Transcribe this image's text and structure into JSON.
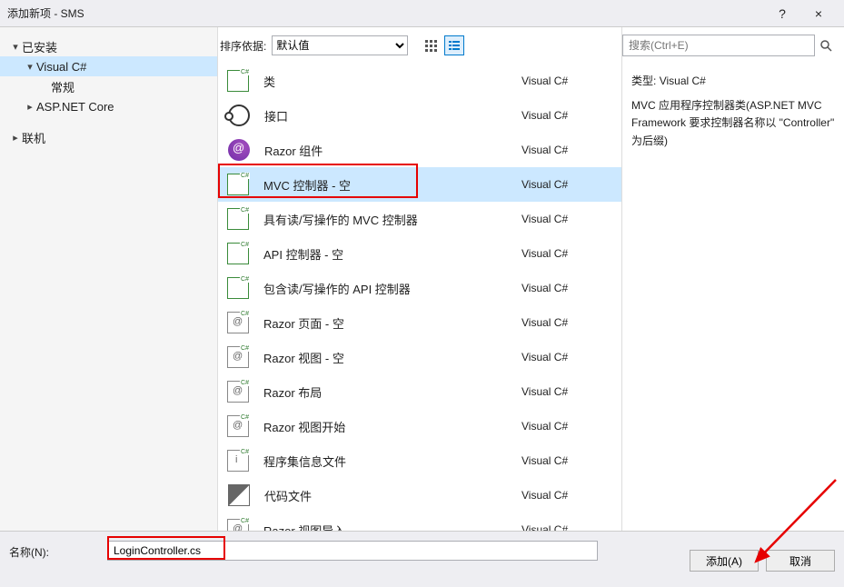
{
  "window": {
    "title": "添加新项 - SMS",
    "help": "?",
    "close": "×"
  },
  "sidebar": {
    "installed": "已安装",
    "visualcs": "Visual C#",
    "general": "常规",
    "aspnetcore": "ASP.NET Core",
    "online": "联机"
  },
  "toolbar": {
    "sortby": "排序依据:",
    "sortvalue": "默认值"
  },
  "items": [
    {
      "label": "类",
      "lang": "Visual C#",
      "ico": "ico-cs"
    },
    {
      "label": "接口",
      "lang": "Visual C#",
      "ico": "ico-interface"
    },
    {
      "label": "Razor 组件",
      "lang": "Visual C#",
      "ico": "ico-razor"
    },
    {
      "label": "MVC 控制器 - 空",
      "lang": "Visual C#",
      "ico": "ico-cs",
      "selected": true
    },
    {
      "label": "具有读/写操作的 MVC 控制器",
      "lang": "Visual C#",
      "ico": "ico-cs"
    },
    {
      "label": "API 控制器 - 空",
      "lang": "Visual C#",
      "ico": "ico-cs"
    },
    {
      "label": "包含读/写操作的 API 控制器",
      "lang": "Visual C#",
      "ico": "ico-cs"
    },
    {
      "label": "Razor 页面 - 空",
      "lang": "Visual C#",
      "ico": "ico-rzfile"
    },
    {
      "label": "Razor 视图 - 空",
      "lang": "Visual C#",
      "ico": "ico-rzfile"
    },
    {
      "label": "Razor 布局",
      "lang": "Visual C#",
      "ico": "ico-rzfile"
    },
    {
      "label": "Razor 视图开始",
      "lang": "Visual C#",
      "ico": "ico-rzfile"
    },
    {
      "label": "程序集信息文件",
      "lang": "Visual C#",
      "ico": "ico-info"
    },
    {
      "label": "代码文件",
      "lang": "Visual C#",
      "ico": "ico-code"
    },
    {
      "label": "Razor 视图导入",
      "lang": "Visual C#",
      "ico": "ico-rzfile"
    }
  ],
  "search": {
    "placeholder": "搜索(Ctrl+E)"
  },
  "detail": {
    "type_label": "类型:",
    "type_value": "Visual C#",
    "desc": "MVC 应用程序控制器类(ASP.NET MVC Framework 要求控制器名称以 \"Controller\" 为后缀)"
  },
  "bottom": {
    "name_label": "名称(N):",
    "name_value": "LoginController.cs",
    "add": "添加(A)",
    "cancel": "取消"
  }
}
